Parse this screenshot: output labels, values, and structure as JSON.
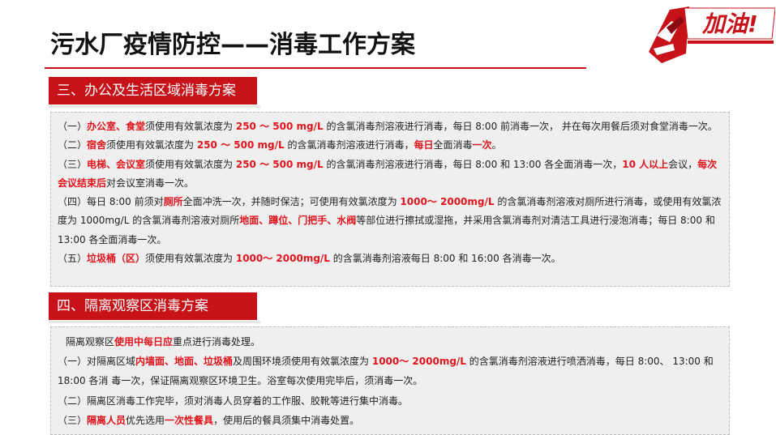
{
  "title": "污水厂疫情防控——消毒工作方案",
  "logo": {
    "text": "加油!"
  },
  "colors": {
    "accent": "#c8121a",
    "highlight": "#e0141c",
    "box_bg": "#efefef"
  },
  "section3": {
    "header": "三、办公及生活区域消毒方案",
    "paragraphs": [
      [
        {
          "t": "（一）"
        },
        {
          "t": "办公室、食堂",
          "hl": true
        },
        {
          "t": "须使用有效氯浓度为 "
        },
        {
          "t": "250 ～ 500 mg/L",
          "hl": true
        },
        {
          "t": " 的含氯消毒剂溶液进行消毒，每日 8:00 前消毒一次， 并在每次用餐后须对食堂消毒一次。"
        }
      ],
      [
        {
          "t": "（二）"
        },
        {
          "t": "宿舍",
          "hl": true
        },
        {
          "t": "须使用有效氯浓度为 "
        },
        {
          "t": "250 ～ 500 mg/L",
          "hl": true
        },
        {
          "t": " 的含氯消毒剂溶液进行消毒，"
        },
        {
          "t": "每日",
          "hl": true
        },
        {
          "t": "全面消毒"
        },
        {
          "t": "一次",
          "hl": true
        },
        {
          "t": "。"
        }
      ],
      [
        {
          "t": "（三）"
        },
        {
          "t": "电梯、会议室",
          "hl": true
        },
        {
          "t": "须使用有效氯浓度为 "
        },
        {
          "t": "250 ～ 500 mg/L",
          "hl": true
        },
        {
          "t": " 的含氯消毒剂溶液进行消毒，每日 8:00 和 13:00 各全面消毒一次，"
        },
        {
          "t": "10 人以上",
          "hl": true
        },
        {
          "t": "会议，"
        },
        {
          "t": "每次会议结束后",
          "hl": true
        },
        {
          "t": "对会议室消毒一次。"
        }
      ],
      [
        {
          "t": "（四）每日 8:00 前须对"
        },
        {
          "t": "厕所",
          "hl": true
        },
        {
          "t": "全面冲洗一次，并随时保洁；可使用有效氯浓度为 "
        },
        {
          "t": "1000～ 2000mg/L",
          "hl": true
        },
        {
          "t": " 的含氯消毒剂溶液对厕所进行消毒，或使用有效氯浓度为 1000mg/L 的含氯消毒剂溶液对厕所"
        },
        {
          "t": "地面、蹲位、门把手、水阀",
          "hl": true
        },
        {
          "t": "等部位进行擦拭或湿拖，并采用含氯消毒剂对清洁工具进行浸泡消毒；每日 8:00 和 13:00 各全面消毒一次。"
        }
      ],
      [
        {
          "t": "（五）"
        },
        {
          "t": "垃圾桶（区）",
          "hl": true
        },
        {
          "t": "须使用有效氯浓度为 "
        },
        {
          "t": "1000～ 2000mg/L",
          "hl": true
        },
        {
          "t": " 的含氯消毒剂溶液每日 8:00 和 16:00 各消毒一次。"
        }
      ]
    ]
  },
  "section4": {
    "header": "四、隔离观察区消毒方案",
    "paragraphs": [
      [
        {
          "t": "隔离观察区"
        },
        {
          "t": "使用中每日应",
          "hl": true
        },
        {
          "t": "重点进行消毒处理。"
        }
      ],
      [
        {
          "t": "（一）对隔离区域"
        },
        {
          "t": "内墙面、地面、垃圾桶",
          "hl": true
        },
        {
          "t": "及周围环境须使用有效氯浓度为 "
        },
        {
          "t": "1000～ 2000mg/L",
          "hl": true
        },
        {
          "t": " 的含氯消毒剂溶液进行喷洒消毒，每日 8:00、 13:00 和 18:00 各消 毒一次，保证隔离观察区环境卫生。浴室每次使用完毕后，须消毒一次。"
        }
      ],
      [
        {
          "t": "（二）隔离区消毒工作完毕，须对消毒人员穿着的工作服、胶靴等进行集中消毒。"
        }
      ],
      [
        {
          "t": "（三）"
        },
        {
          "t": "隔离人员",
          "hl": true
        },
        {
          "t": "优先选用"
        },
        {
          "t": "一次性餐具",
          "hl": true
        },
        {
          "t": "，使用后的餐具须集中消毒处置。"
        }
      ]
    ]
  }
}
